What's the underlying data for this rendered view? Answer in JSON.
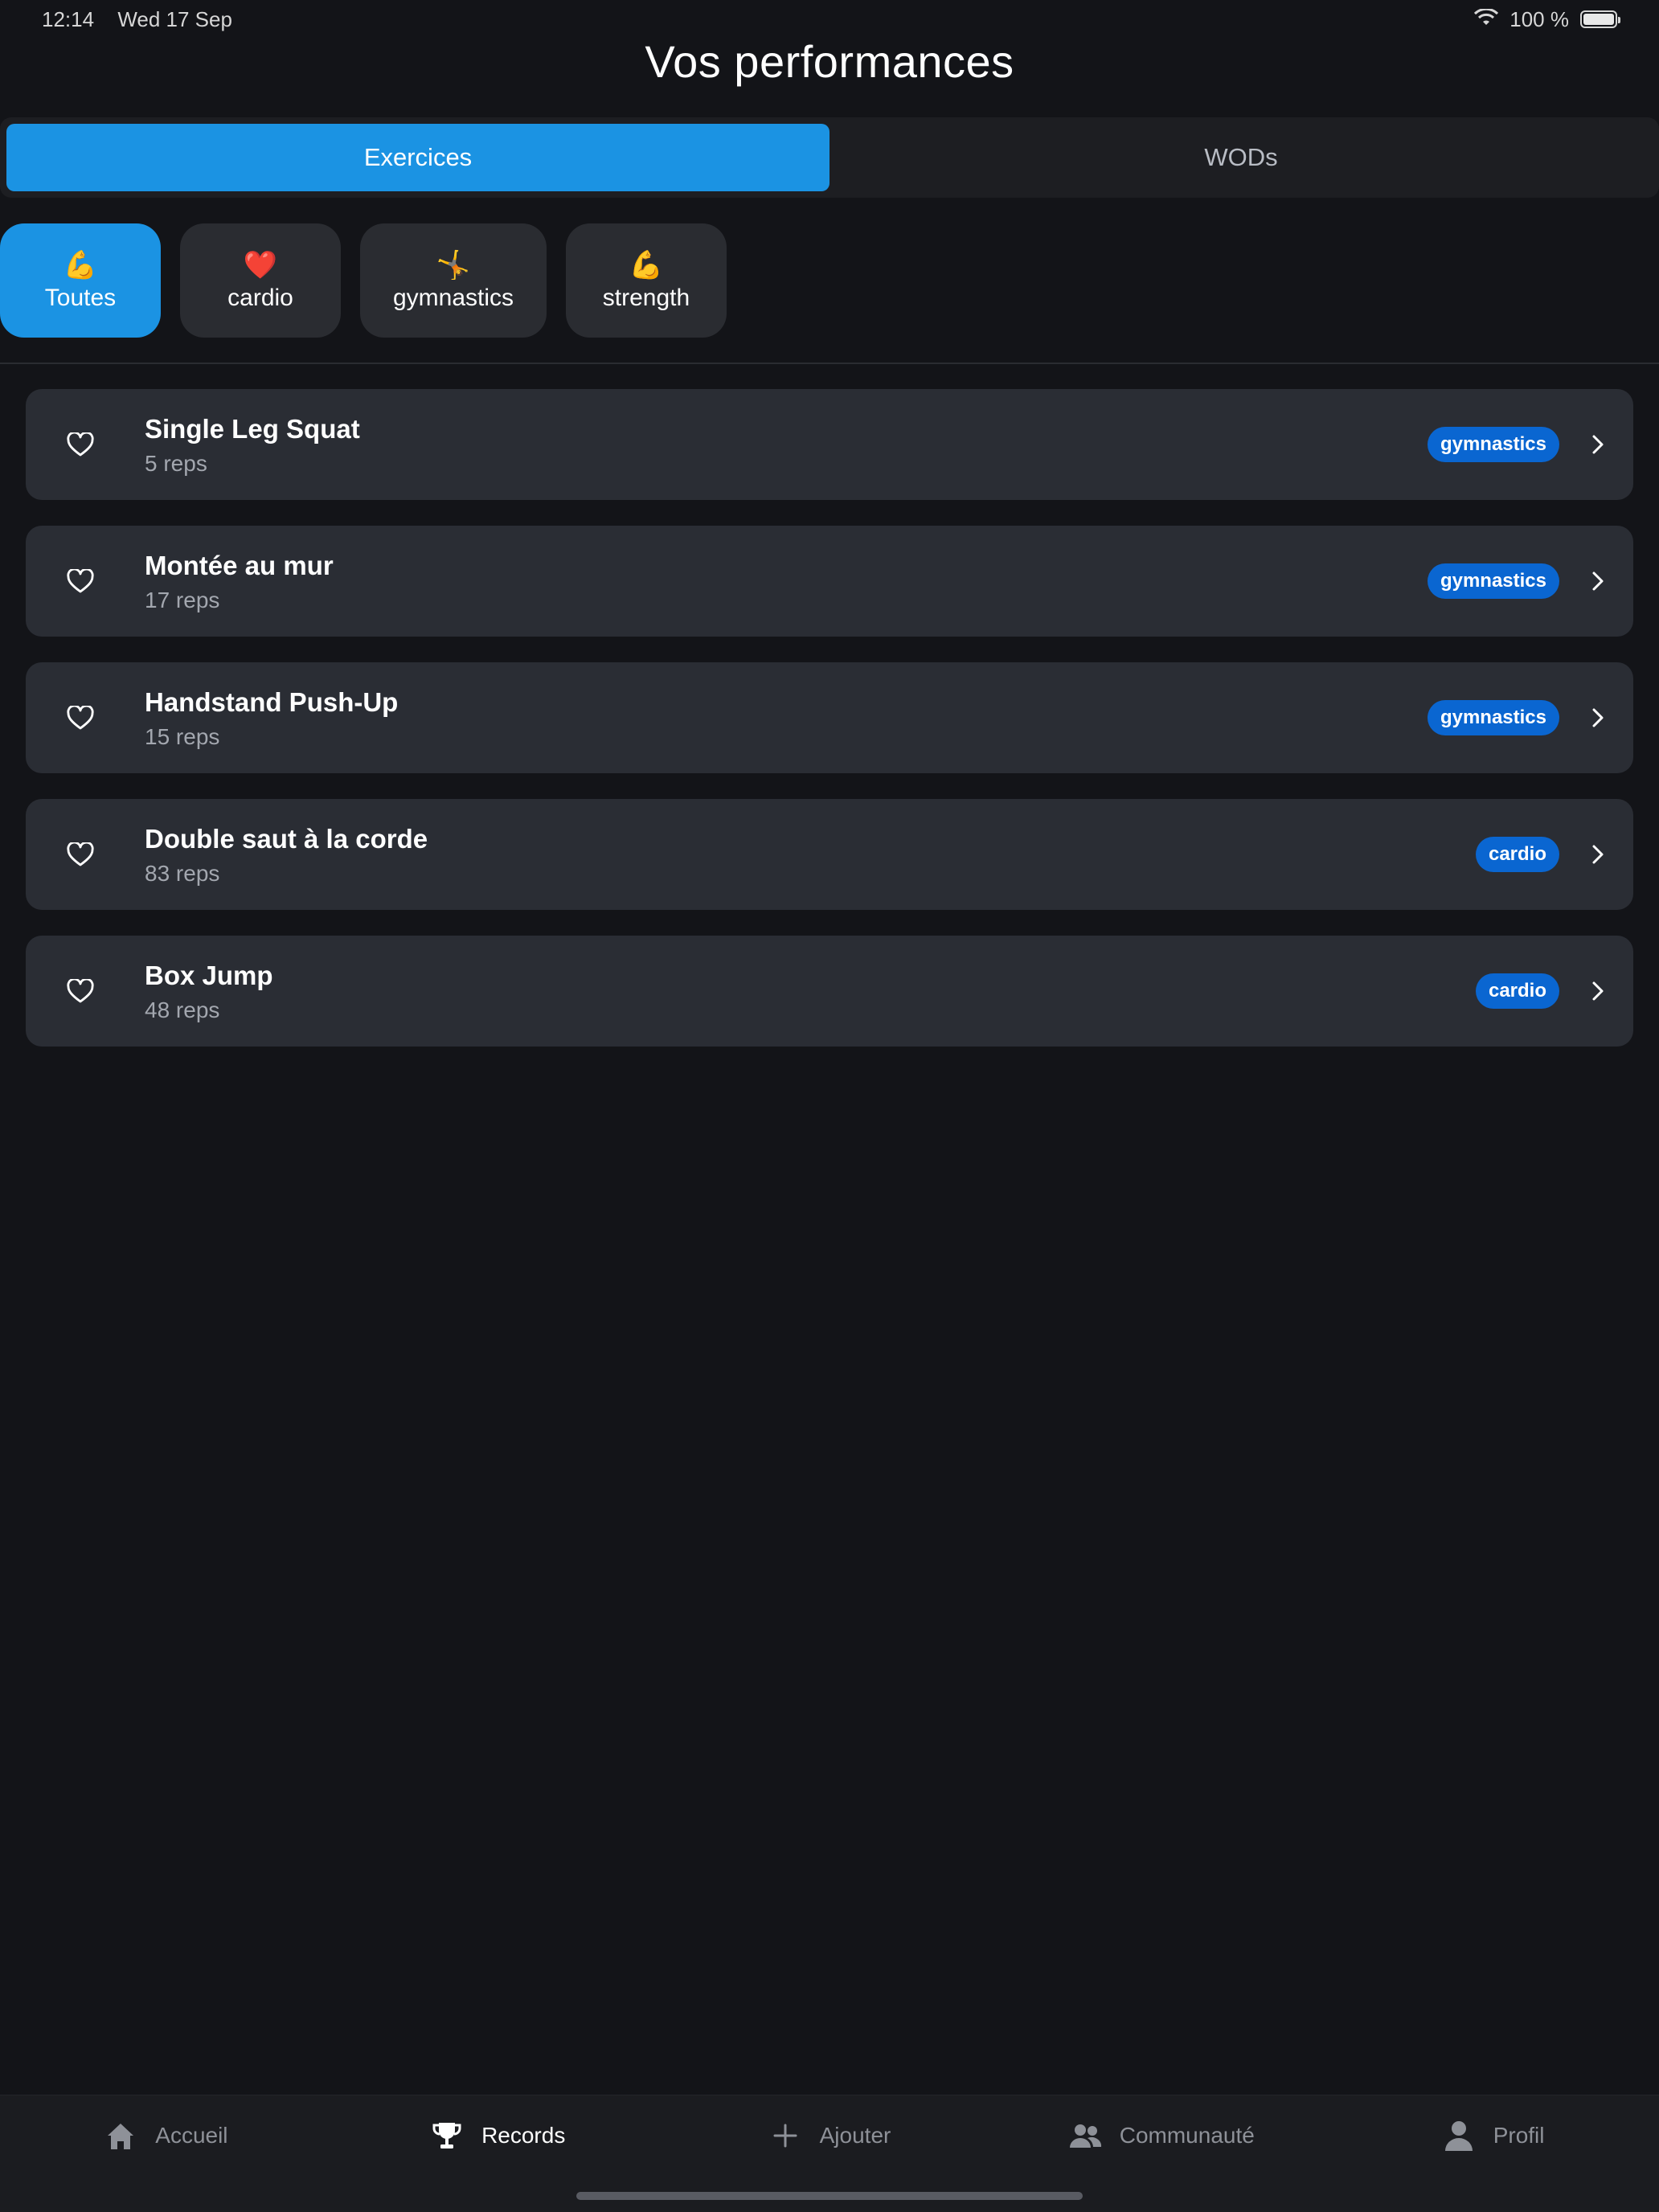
{
  "status_bar": {
    "time": "12:14",
    "date": "Wed 17 Sep",
    "battery": "100 %"
  },
  "header": {
    "title": "Vos performances"
  },
  "segments": [
    {
      "label": "Exercices",
      "active": true
    },
    {
      "label": "WODs",
      "active": false
    }
  ],
  "categories": [
    {
      "emoji": "💪",
      "label": "Toutes",
      "active": true
    },
    {
      "emoji": "❤️",
      "label": "cardio",
      "active": false
    },
    {
      "emoji": "🤸",
      "label": "gymnastics",
      "active": false
    },
    {
      "emoji": "💪",
      "label": "strength",
      "active": false
    }
  ],
  "exercises": [
    {
      "name": "Single Leg Squat",
      "reps": "5 reps",
      "tag": "gymnastics"
    },
    {
      "name": "Montée au mur",
      "reps": "17 reps",
      "tag": "gymnastics"
    },
    {
      "name": "Handstand Push-Up",
      "reps": "15 reps",
      "tag": "gymnastics"
    },
    {
      "name": "Double saut à la corde",
      "reps": "83 reps",
      "tag": "cardio"
    },
    {
      "name": "Box Jump",
      "reps": "48 reps",
      "tag": "cardio"
    }
  ],
  "tab_bar": [
    {
      "label": "Accueil",
      "icon": "home-icon",
      "active": false
    },
    {
      "label": "Records",
      "icon": "trophy-icon",
      "active": true
    },
    {
      "label": "Ajouter",
      "icon": "plus-icon",
      "active": false
    },
    {
      "label": "Communauté",
      "icon": "people-icon",
      "active": false
    },
    {
      "label": "Profil",
      "icon": "person-icon",
      "active": false
    }
  ],
  "colors": {
    "accent": "#1b93e3",
    "badge": "#0a66d1",
    "background": "#131418",
    "card": "#2a2d34"
  }
}
